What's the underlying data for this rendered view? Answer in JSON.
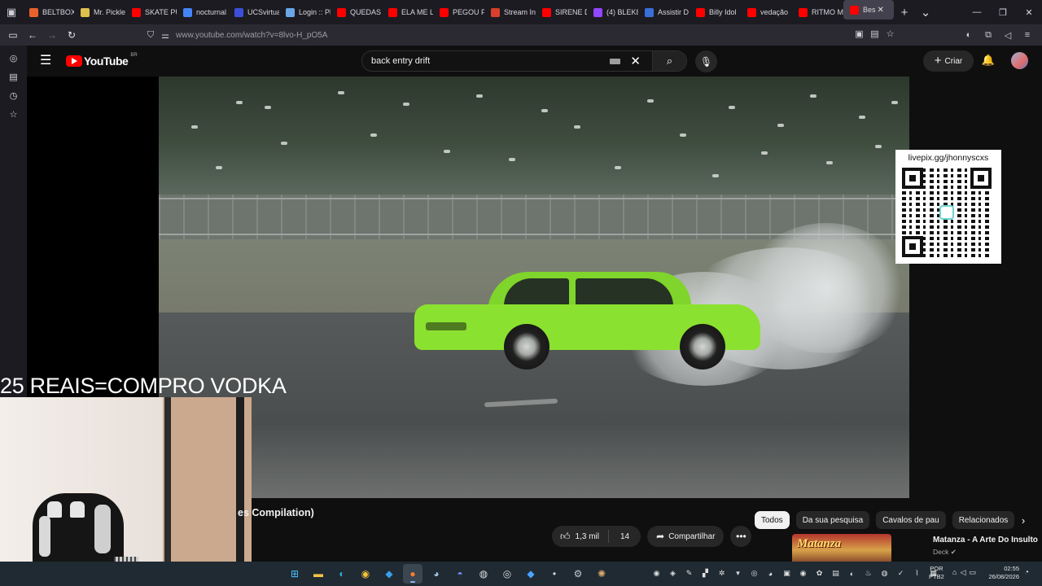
{
  "browser": {
    "tabs": [
      {
        "label": "BELTBOX",
        "color": "#e8622d"
      },
      {
        "label": "Mr. Pickle",
        "color": "#e0c04d"
      },
      {
        "label": "SKATE PU",
        "color": "#ff0000"
      },
      {
        "label": "nocturnal",
        "color": "#4285f4"
      },
      {
        "label": "UCSvirtua",
        "color": "#3b4fd8"
      },
      {
        "label": "Login :: Pl",
        "color": "#6aa6e8"
      },
      {
        "label": "QUEDAS",
        "color": "#ff0000"
      },
      {
        "label": "ELA ME LI",
        "color": "#ff0000"
      },
      {
        "label": "PEGOU FC",
        "color": "#ff0000"
      },
      {
        "label": "Stream In",
        "color": "#d9402b"
      },
      {
        "label": "SIRENE D",
        "color": "#ff0000"
      },
      {
        "label": "(4) BLEK8",
        "color": "#9146ff"
      },
      {
        "label": "Assistir D",
        "color": "#3a6fd8"
      },
      {
        "label": "Billy Idol",
        "color": "#ff0000"
      },
      {
        "label": "vedação",
        "color": "#ff0000"
      },
      {
        "label": "RITMO M",
        "color": "#ff0000"
      },
      {
        "label": "Bes",
        "color": "#ff0000"
      }
    ],
    "url": "www.youtube.com/watch?v=8lvo-H_pO5A"
  },
  "youtube": {
    "logo_text": "YouTube",
    "region": "BR",
    "search_query": "back entry drift",
    "create_label": "Criar"
  },
  "video": {
    "qr_text": "livepix.gg/jhonnyscxs",
    "overlay_text": "25 REAIS=COMPRO VODKA",
    "title_fragment": "es Compilation)",
    "likes": "1,3 mil",
    "dislikes": "14",
    "share_label": "Compartilhar"
  },
  "related": {
    "chips": [
      "Todos",
      "Da sua pesquisa",
      "Cavalos de pau",
      "Relacionados"
    ],
    "active_chip": "Todos",
    "first": {
      "thumb_text": "Matanza",
      "title": "Matanza - A Arte Do Insulto",
      "channel": "Deck"
    }
  },
  "taskbar": {
    "lang_1": "POR",
    "lang_2": "PTB2",
    "time": "02:55",
    "date": "26/08/2026"
  }
}
